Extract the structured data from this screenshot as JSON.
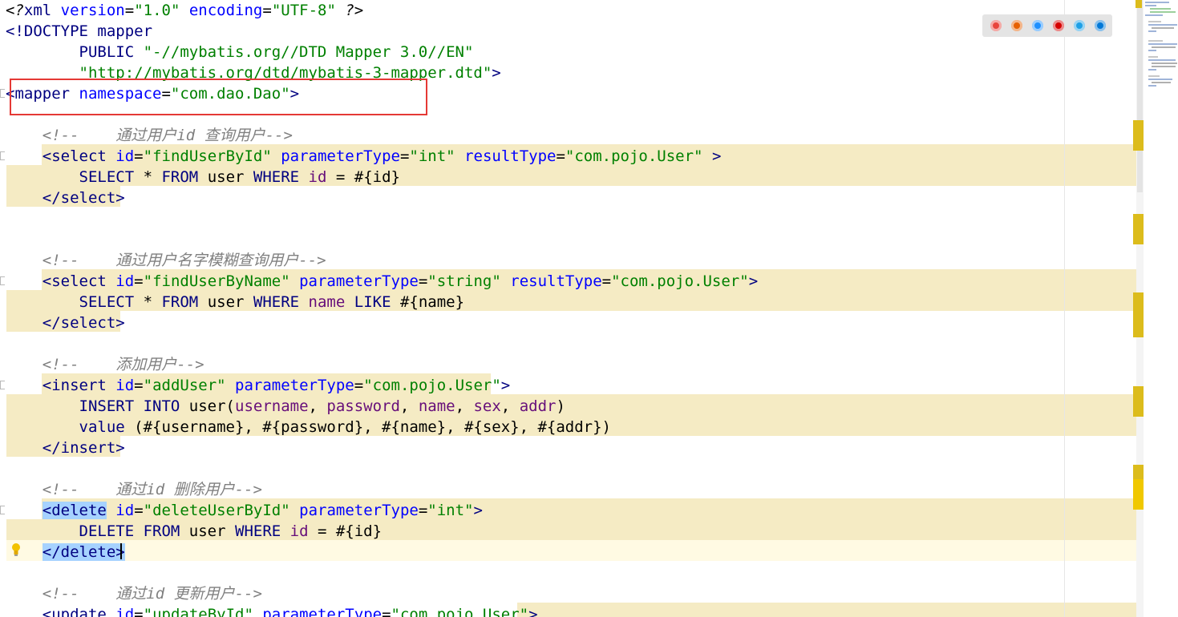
{
  "colors": {
    "tag": "#000080",
    "attribute": "#0000ff",
    "value": "#008000",
    "comment": "#808080",
    "column": "#660e7a",
    "highlight": "#f5ebc4",
    "selection": "#a6d2ff",
    "annotation_box": "#e53935"
  },
  "editor": {
    "lines": [
      [
        {
          "t": "<?",
          "c": "tk-pi"
        },
        {
          "t": "xml ",
          "c": "tk-tag"
        },
        {
          "t": "version",
          "c": "tk-attr"
        },
        {
          "t": "=",
          "c": "tk-txt"
        },
        {
          "t": "\"1.0\"",
          "c": "tk-val"
        },
        {
          "t": " ",
          "c": "tk-txt"
        },
        {
          "t": "encoding",
          "c": "tk-attr"
        },
        {
          "t": "=",
          "c": "tk-txt"
        },
        {
          "t": "\"UTF-8\"",
          "c": "tk-val"
        },
        {
          "t": " ?>",
          "c": "tk-pi"
        }
      ],
      [
        {
          "t": "<!DOCTYPE mapper",
          "c": "tk-tag"
        }
      ],
      [
        {
          "t": "        PUBLIC ",
          "c": "tk-tag"
        },
        {
          "t": "\"-//mybatis.org//DTD Mapper 3.0//EN\"",
          "c": "tk-val"
        }
      ],
      [
        {
          "t": "        ",
          "c": "tk-txt"
        },
        {
          "t": "\"http://mybatis.org/dtd/mybatis-3-mapper.dtd\"",
          "c": "tk-val"
        },
        {
          "t": ">",
          "c": "tk-tag"
        }
      ],
      [
        {
          "t": "<mapper ",
          "c": "tk-tag"
        },
        {
          "t": "namespace",
          "c": "tk-attr"
        },
        {
          "t": "=",
          "c": "tk-txt"
        },
        {
          "t": "\"com.dao.Dao\"",
          "c": "tk-val"
        },
        {
          "t": ">",
          "c": "tk-tag"
        }
      ],
      [],
      [
        {
          "t": "    <!--    通过用户id 查询用户-->",
          "c": "tk-cmt"
        }
      ],
      [
        {
          "t": "    <select ",
          "c": "tk-tag"
        },
        {
          "t": "id",
          "c": "tk-attr"
        },
        {
          "t": "=",
          "c": "tk-txt"
        },
        {
          "t": "\"findUserById\"",
          "c": "tk-val"
        },
        {
          "t": " ",
          "c": "tk-txt"
        },
        {
          "t": "parameterType",
          "c": "tk-attr"
        },
        {
          "t": "=",
          "c": "tk-txt"
        },
        {
          "t": "\"int\"",
          "c": "tk-val"
        },
        {
          "t": " ",
          "c": "tk-txt"
        },
        {
          "t": "resultType",
          "c": "tk-attr"
        },
        {
          "t": "=",
          "c": "tk-txt"
        },
        {
          "t": "\"com.pojo.User\"",
          "c": "tk-val"
        },
        {
          "t": " >",
          "c": "tk-tag"
        }
      ],
      [
        {
          "t": "        ",
          "c": "tk-txt"
        },
        {
          "t": "SELECT",
          "c": "tk-kw"
        },
        {
          "t": " * ",
          "c": "tk-txt"
        },
        {
          "t": "FROM",
          "c": "tk-kw"
        },
        {
          "t": " user ",
          "c": "tk-id"
        },
        {
          "t": "WHERE",
          "c": "tk-kw"
        },
        {
          "t": " ",
          "c": "tk-txt"
        },
        {
          "t": "id",
          "c": "tk-col"
        },
        {
          "t": " = #{id}",
          "c": "tk-txt"
        }
      ],
      [
        {
          "t": "    </select>",
          "c": "tk-tag"
        }
      ],
      [],
      [],
      [
        {
          "t": "    <!--    通过用户名字模糊查询用户-->",
          "c": "tk-cmt"
        }
      ],
      [
        {
          "t": "    <select ",
          "c": "tk-tag"
        },
        {
          "t": "id",
          "c": "tk-attr"
        },
        {
          "t": "=",
          "c": "tk-txt"
        },
        {
          "t": "\"findUserByName\"",
          "c": "tk-val"
        },
        {
          "t": " ",
          "c": "tk-txt"
        },
        {
          "t": "parameterType",
          "c": "tk-attr"
        },
        {
          "t": "=",
          "c": "tk-txt"
        },
        {
          "t": "\"string\"",
          "c": "tk-val"
        },
        {
          "t": " ",
          "c": "tk-txt"
        },
        {
          "t": "resultType",
          "c": "tk-attr"
        },
        {
          "t": "=",
          "c": "tk-txt"
        },
        {
          "t": "\"com.pojo.User\"",
          "c": "tk-val"
        },
        {
          "t": ">",
          "c": "tk-tag"
        }
      ],
      [
        {
          "t": "        ",
          "c": "tk-txt"
        },
        {
          "t": "SELECT",
          "c": "tk-kw"
        },
        {
          "t": " * ",
          "c": "tk-txt"
        },
        {
          "t": "FROM",
          "c": "tk-kw"
        },
        {
          "t": " user ",
          "c": "tk-id"
        },
        {
          "t": "WHERE",
          "c": "tk-kw"
        },
        {
          "t": " ",
          "c": "tk-txt"
        },
        {
          "t": "name",
          "c": "tk-col"
        },
        {
          "t": " ",
          "c": "tk-txt"
        },
        {
          "t": "LIKE",
          "c": "tk-kw"
        },
        {
          "t": " #{name}",
          "c": "tk-txt"
        }
      ],
      [
        {
          "t": "    </select>",
          "c": "tk-tag"
        }
      ],
      [],
      [
        {
          "t": "    <!--    添加用户-->",
          "c": "tk-cmt"
        }
      ],
      [
        {
          "t": "    <insert ",
          "c": "tk-tag"
        },
        {
          "t": "id",
          "c": "tk-attr"
        },
        {
          "t": "=",
          "c": "tk-txt"
        },
        {
          "t": "\"addUser\"",
          "c": "tk-val"
        },
        {
          "t": " ",
          "c": "tk-txt"
        },
        {
          "t": "parameterType",
          "c": "tk-attr"
        },
        {
          "t": "=",
          "c": "tk-txt"
        },
        {
          "t": "\"com.pojo.User\"",
          "c": "tk-val"
        },
        {
          "t": ">",
          "c": "tk-tag"
        }
      ],
      [
        {
          "t": "        ",
          "c": "tk-txt"
        },
        {
          "t": "INSERT INTO",
          "c": "tk-kw"
        },
        {
          "t": " user(",
          "c": "tk-id"
        },
        {
          "t": "username",
          "c": "tk-col"
        },
        {
          "t": ", ",
          "c": "tk-txt"
        },
        {
          "t": "password",
          "c": "tk-col"
        },
        {
          "t": ", ",
          "c": "tk-txt"
        },
        {
          "t": "name",
          "c": "tk-col"
        },
        {
          "t": ", ",
          "c": "tk-txt"
        },
        {
          "t": "sex",
          "c": "tk-col"
        },
        {
          "t": ", ",
          "c": "tk-txt"
        },
        {
          "t": "addr",
          "c": "tk-col"
        },
        {
          "t": ")",
          "c": "tk-txt"
        }
      ],
      [
        {
          "t": "        ",
          "c": "tk-txt"
        },
        {
          "t": "value",
          "c": "tk-kw"
        },
        {
          "t": " (#{username}, #{password}, #{name}, #{sex}, #{addr})",
          "c": "tk-txt"
        }
      ],
      [
        {
          "t": "    </insert>",
          "c": "tk-tag"
        }
      ],
      [],
      [
        {
          "t": "    <!--    通过id 删除用户-->",
          "c": "tk-cmt"
        }
      ],
      [
        {
          "t": "    ",
          "c": "tk-txt"
        },
        {
          "t": "<delete",
          "c": "tk-tag tk-sel"
        },
        {
          "t": " ",
          "c": "tk-txt"
        },
        {
          "t": "id",
          "c": "tk-attr"
        },
        {
          "t": "=",
          "c": "tk-txt"
        },
        {
          "t": "\"deleteUserById\"",
          "c": "tk-val"
        },
        {
          "t": " ",
          "c": "tk-txt"
        },
        {
          "t": "parameterType",
          "c": "tk-attr"
        },
        {
          "t": "=",
          "c": "tk-txt"
        },
        {
          "t": "\"int\"",
          "c": "tk-val"
        },
        {
          "t": ">",
          "c": "tk-tag"
        }
      ],
      [
        {
          "t": "        ",
          "c": "tk-txt"
        },
        {
          "t": "DELETE FROM",
          "c": "tk-kw"
        },
        {
          "t": " user ",
          "c": "tk-id"
        },
        {
          "t": "WHERE",
          "c": "tk-kw"
        },
        {
          "t": " ",
          "c": "tk-txt"
        },
        {
          "t": "id",
          "c": "tk-col"
        },
        {
          "t": " = #{id}",
          "c": "tk-txt"
        }
      ],
      [
        {
          "t": "    ",
          "c": "tk-txt"
        },
        {
          "t": "</delete>",
          "c": "tk-tag tk-sel"
        }
      ],
      [],
      [
        {
          "t": "    <!--    通过id 更新用户-->",
          "c": "tk-cmt"
        }
      ],
      [
        {
          "t": "    <update ",
          "c": "tk-tag"
        },
        {
          "t": "id",
          "c": "tk-attr"
        },
        {
          "t": "=",
          "c": "tk-txt"
        },
        {
          "t": "\"updateById\"",
          "c": "tk-val"
        },
        {
          "t": " ",
          "c": "tk-txt"
        },
        {
          "t": "parameterType",
          "c": "tk-attr"
        },
        {
          "t": "=",
          "c": "tk-txt"
        },
        {
          "t": "\"com.pojo.User\"",
          "c": "tk-val"
        },
        {
          "t": ">",
          "c": "tk-tag"
        }
      ]
    ]
  },
  "browser_icons": [
    {
      "name": "chrome-icon",
      "color": "#e8453c"
    },
    {
      "name": "firefox-icon",
      "color": "#e66000"
    },
    {
      "name": "safari-icon",
      "color": "#1e90ff"
    },
    {
      "name": "opera-icon",
      "color": "#d50000"
    },
    {
      "name": "ie-icon",
      "color": "#1ea0e6"
    },
    {
      "name": "edge-icon",
      "color": "#0078d7"
    }
  ]
}
